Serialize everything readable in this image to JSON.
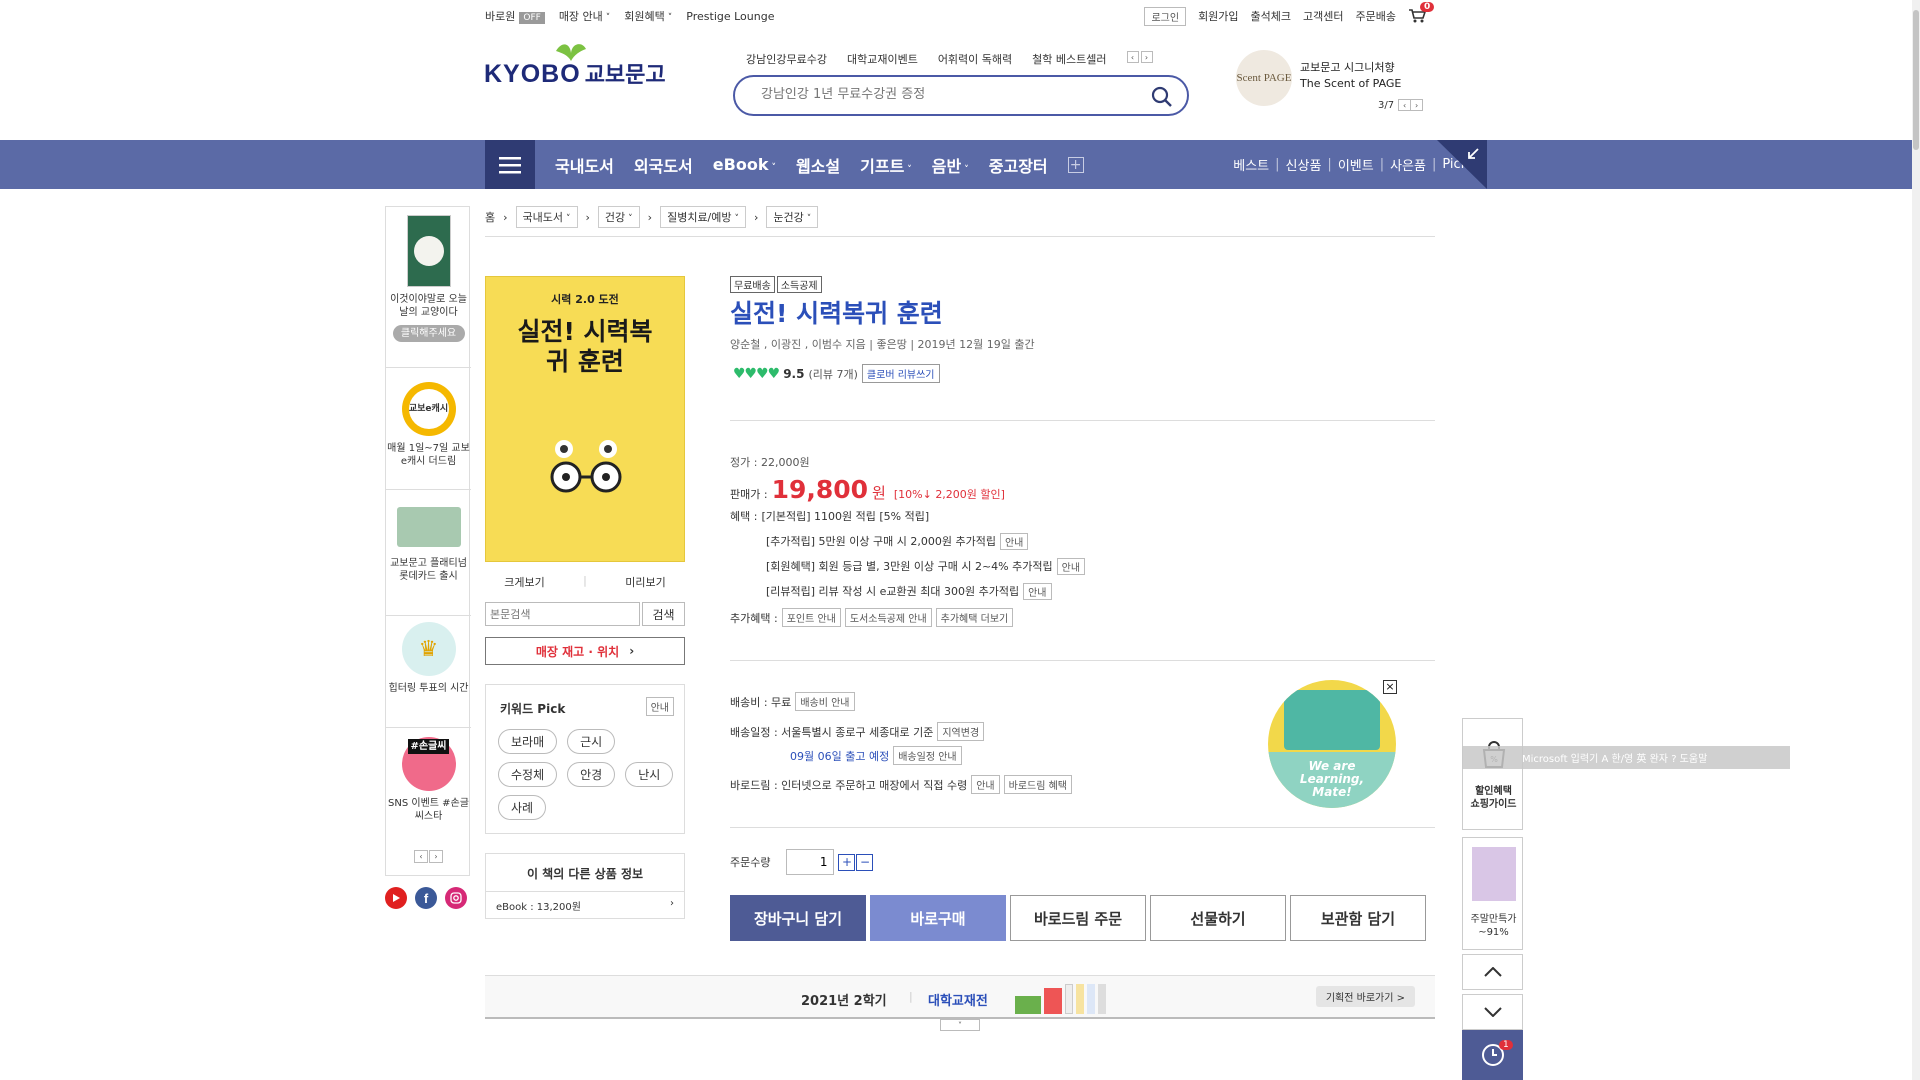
{
  "util": {
    "quick_buy": "바로원",
    "quick_buy_status": "OFF",
    "store_info": "매장 안내",
    "member_benefits": "회원혜택",
    "prestige": "Prestige Lounge",
    "login": "로그인",
    "signup": "회원가입",
    "attendance": "출석체크",
    "customer_center": "고객센터",
    "order_delivery": "주문배송",
    "cart_count": "0"
  },
  "header": {
    "logo_en": "KYOBO",
    "logo_ko": "교보문고",
    "quick_links": [
      "강남인강무료수강",
      "대학교재이벤트",
      "어휘력이 독해력",
      "철학 베스트셀러"
    ],
    "search_placeholder": "강남인강 1년 무료수강권 증정",
    "promo_line1": "교보문고 시그니처향",
    "promo_line2": "The Scent of PAGE",
    "promo_badge": "Scent PAGE",
    "promo_pager": "3/7"
  },
  "nav": {
    "items": [
      "국내도서",
      "외국도서",
      "eBook",
      "웹소설",
      "기프트",
      "음반",
      "중고장터"
    ],
    "sub_items": [
      "베스트",
      "신상품",
      "이벤트",
      "사은품",
      "Picks"
    ]
  },
  "breadcrumb": [
    "홈",
    "국내도서",
    "건강",
    "질병치료/예방",
    "눈건강"
  ],
  "left_banner": [
    {
      "text": "이것이야말로 오늘날의 교양이다",
      "button": "클릭해주세요"
    },
    {
      "text": "매월 1일~7일 교보e캐시 더드림",
      "icon_text": "교보e캐시"
    },
    {
      "text": "교보문고 플래티넘 롯데카드 출시"
    },
    {
      "text": "힙터링 투표의 시간"
    },
    {
      "text": "SNS 이벤트 #손글씨스타",
      "icon_text": "#손글씨"
    }
  ],
  "book": {
    "cover_top": "시력 2.0 도전",
    "cover_title": "실전! 시력복귀 훈련",
    "badges": [
      "무료배송",
      "소득공제"
    ],
    "title": "실전! 시력복귀 훈련",
    "meta": "양순철 , 이광진 , 이범수 지음 | 좋은땅 | 2019년 12월 19일 출간",
    "rating": "9.5",
    "review_count": "(리뷰 7개)",
    "review_write": "클로버 리뷰쓰기",
    "zoom_label": "크게보기",
    "preview_label": "미리보기",
    "text_search_placeholder": "본문검색",
    "text_search_button": "검색",
    "store_stock": "매장 재고 · 위치"
  },
  "price": {
    "list_label": "정가 :",
    "list_price": "22,000원",
    "sale_label": "판매가 :",
    "sale_price": "19,800",
    "sale_unit": "원",
    "discount": "[10%↓ 2,200원 할인]",
    "benefit_label": "혜택 :",
    "benefits": [
      {
        "text": "[기본적립] 1100원 적립 [5% 적립]",
        "btn": ""
      },
      {
        "text": "[추가적립] 5만원 이상 구매 시 2,000원 추가적립",
        "btn": "안내"
      },
      {
        "text": "[회원혜택] 회원 등급 별, 3만원 이상 구매 시 2~4% 추가적립",
        "btn": "안내"
      },
      {
        "text": "[리뷰적립] 리뷰 작성 시 e교환권 최대 300원 추가적립",
        "btn": "안내"
      }
    ],
    "extra_label": "추가혜택 :",
    "extra_btns": [
      "포인트 안내",
      "도서소득공제 안내",
      "추가혜택 더보기"
    ]
  },
  "shipping": {
    "fee_label": "배송비 : 무료",
    "fee_btn": "배송비 안내",
    "date_label": "배송일정 : 서울특별시 종로구 세종대로 기준",
    "region_btn": "지역변경",
    "ship_date": "09월 06일 출고 예정",
    "schedule_btn": "배송일정 안내",
    "barodrim_label": "바로드림 : 인터넷으로 주문하고 매장에서 직접 수령",
    "barodrim_btn1": "안내",
    "barodrim_btn2": "바로드림 혜택",
    "promo_line1": "We are",
    "promo_line2": "Learning,",
    "promo_line3": "Mate!"
  },
  "order": {
    "qty_label": "주문수량",
    "qty_value": "1",
    "buttons": [
      "장바구니 담기",
      "바로구매",
      "바로드림 주문",
      "선물하기",
      "보관함 담기"
    ]
  },
  "keyword": {
    "title": "키워드 Pick",
    "info_btn": "안내",
    "pills": [
      "보라매",
      "근시",
      "수정체",
      "안경",
      "난시",
      "사례"
    ]
  },
  "other_products": {
    "title": "이 책의 다른 상품 정보",
    "item": "eBook : 13,200원"
  },
  "bottom_banner": {
    "semester": "2021년 2학기",
    "label": "대학교재전",
    "cta": "기획전 바로가기 >"
  },
  "right_float": {
    "guide_line1": "할인혜택",
    "guide_line2": "쇼핑가이드",
    "deal_line1": "주말만특가",
    "deal_line2": "~91%",
    "recent_count": "1",
    "ime_text": "Microsoft 입력기 A 한/영 英 완자 ? 도움말"
  },
  "colors": {
    "brand_blue": "#5b6aa6",
    "nav_dark": "#2f3b73",
    "title_blue": "#2b4fb9",
    "price_red": "#e0303a",
    "rating_green": "#2dbb6b"
  }
}
